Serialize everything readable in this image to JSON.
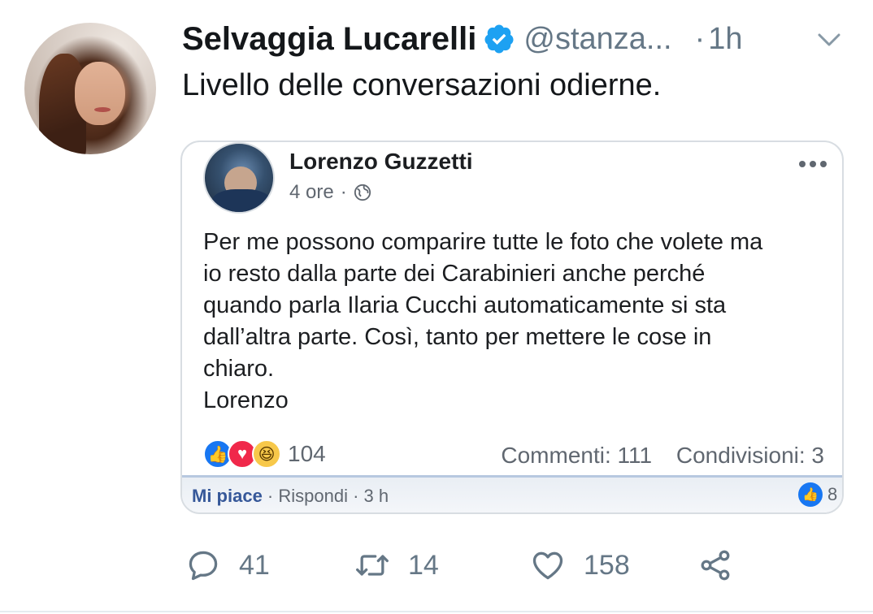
{
  "tweet": {
    "author_name": "Selvaggia Lucarelli",
    "handle": "@stanza...",
    "separator": "·",
    "time": "1h",
    "text": "Livello delle conversazioni odierne.",
    "actions": {
      "replies": "41",
      "retweets": "14",
      "likes": "158"
    }
  },
  "embed": {
    "author": "Lorenzo Guzzetti",
    "time": "4 ore",
    "separator": "·",
    "post_lines": [
      "Per me possono comparire tutte le foto che volete ma",
      "io resto dalla parte dei Carabinieri anche perché",
      "quando parla Ilaria Cucchi automaticamente si sta",
      "dall’altra parte. Così, tanto per mettere le cose in",
      "chiaro.",
      "Lorenzo"
    ],
    "reaction_count": "104",
    "comments": "Commenti: 111",
    "shares": "Condivisioni: 3",
    "comment_strip": {
      "like": "Mi piace",
      "reply": "Rispondi",
      "time": "3 h",
      "sep": " · ",
      "like_count": "8"
    }
  },
  "colors": {
    "text_primary": "#14171a",
    "text_secondary": "#657786",
    "verified": "#1da1f2",
    "fb_blue": "#1877f2",
    "fb_love": "#f0284a",
    "fb_haha": "#f7c84a"
  },
  "icons": [
    "verified-badge-icon",
    "chevron-down-icon",
    "globe-icon",
    "more-icon",
    "reply-icon",
    "retweet-icon",
    "like-icon",
    "share-icon"
  ]
}
